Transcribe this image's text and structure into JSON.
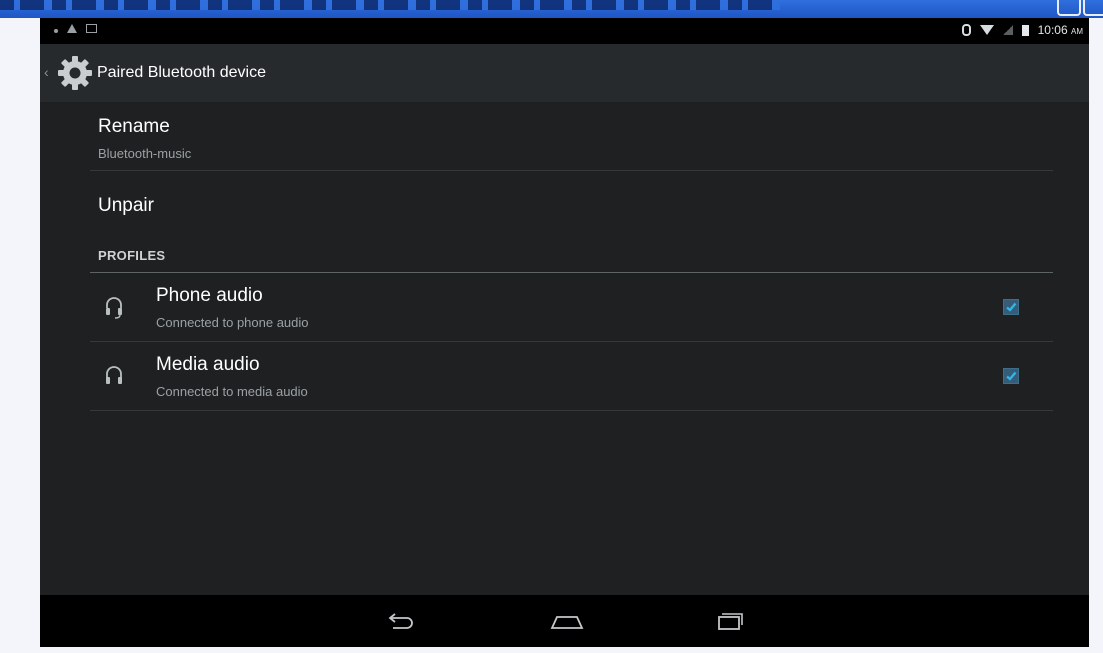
{
  "status": {
    "time": "10:06",
    "ampm": "AM"
  },
  "action_bar": {
    "title": "Paired Bluetooth device",
    "back": "‹"
  },
  "rename": {
    "title": "Rename",
    "subtitle": "Bluetooth-music"
  },
  "unpair": {
    "title": "Unpair"
  },
  "profiles": {
    "header": "PROFILES",
    "items": [
      {
        "title": "Phone audio",
        "subtitle": "Connected to phone audio",
        "checked": true,
        "icon": "headset-icon"
      },
      {
        "title": "Media audio",
        "subtitle": "Connected to media audio",
        "checked": true,
        "icon": "headphones-icon"
      }
    ]
  },
  "colors": {
    "accent": "#33b5e5",
    "background": "#1e2021"
  }
}
